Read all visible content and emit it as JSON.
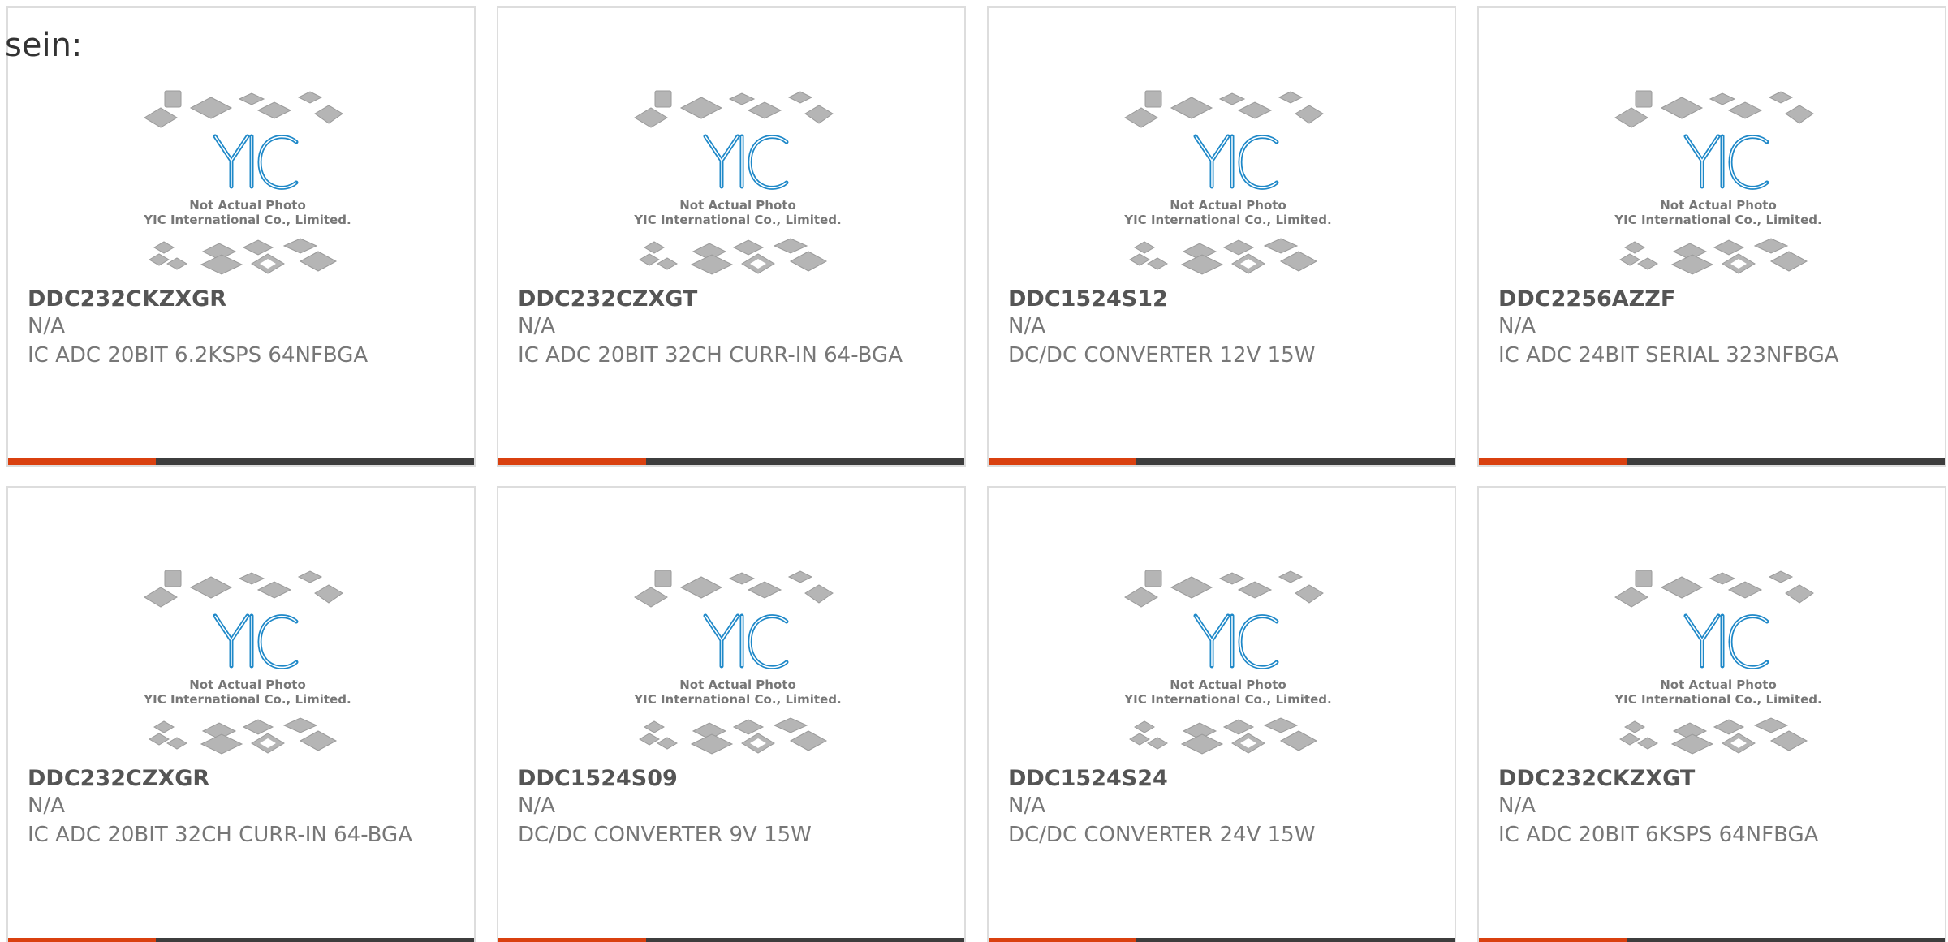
{
  "intro_text": "sein:",
  "photo": {
    "logo_text": "YIC",
    "caption_line1": "Not Actual Photo",
    "caption_line2": "YIC International Co., Limited."
  },
  "colors": {
    "accent": "#d9400f",
    "bar": "#3d3d3d",
    "logo": "#1e88c8"
  },
  "products": [
    {
      "part": "DDC232CKZXGR",
      "mfr": "N/A",
      "desc": "IC ADC 20BIT 6.2KSPS 64NFBGA"
    },
    {
      "part": "DDC232CZXGT",
      "mfr": "N/A",
      "desc": "IC ADC 20BIT 32CH CURR-IN 64-BGA"
    },
    {
      "part": "DDC1524S12",
      "mfr": "N/A",
      "desc": "DC/DC CONVERTER 12V 15W"
    },
    {
      "part": "DDC2256AZZF",
      "mfr": "N/A",
      "desc": "IC ADC 24BIT SERIAL 323NFBGA"
    },
    {
      "part": "DDC232CZXGR",
      "mfr": "N/A",
      "desc": "IC ADC 20BIT 32CH CURR-IN 64-BGA"
    },
    {
      "part": "DDC1524S09",
      "mfr": "N/A",
      "desc": "DC/DC CONVERTER 9V 15W"
    },
    {
      "part": "DDC1524S24",
      "mfr": "N/A",
      "desc": "DC/DC CONVERTER 24V 15W"
    },
    {
      "part": "DDC232CKZXGT",
      "mfr": "N/A",
      "desc": "IC ADC 20BIT 6KSPS 64NFBGA"
    }
  ]
}
